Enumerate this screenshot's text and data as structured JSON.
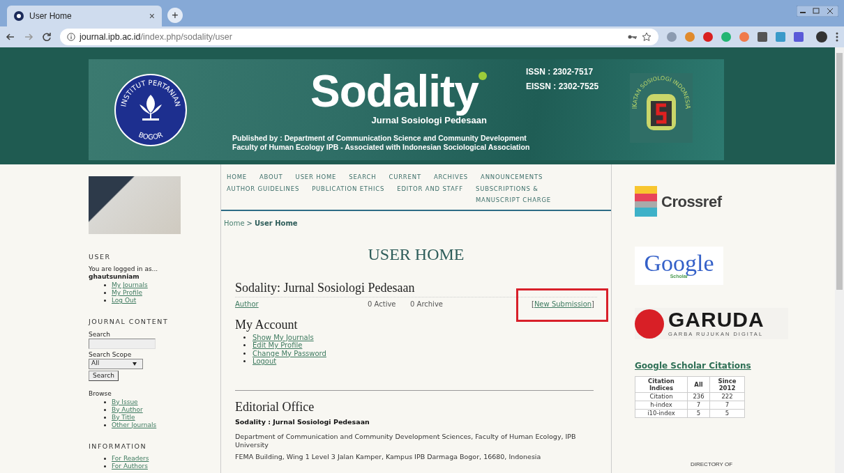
{
  "browser": {
    "tab": {
      "title": "User Home",
      "close": "×"
    },
    "new_tab": "+",
    "url": {
      "host": "journal.ipb.ac.id",
      "path": "/index.php/sodality/user"
    }
  },
  "banner": {
    "seal_text_top": "INSTITUT PERTANIAN",
    "seal_text_bottom": "BOGOR",
    "title": "Sodality",
    "subtitle": "Jurnal Sosiologi Pedesaan",
    "issn": "ISSN : 2302-7517",
    "eissn": "EISSN : 2302-7525",
    "published_lines": [
      "Published by : Department of Communication Science and Community Development",
      "Faculty of Human Ecology IPB - Associated with Indonesian Sociological Association"
    ],
    "association_text": "IKATAN SOSIOLOGI INDONESIA"
  },
  "sidebar": {
    "user": {
      "heading": "USER",
      "logged_in": "You are logged in as...",
      "username": "ghautsunniam",
      "links": [
        "My Journals",
        "My Profile",
        "Log Out"
      ]
    },
    "journal_content": {
      "heading": "JOURNAL CONTENT",
      "search_label": "Search",
      "scope_label": "Search Scope",
      "scope_value": "All",
      "search_button": "Search",
      "browse_label": "Browse",
      "browse_links": [
        "By Issue",
        "By Author",
        "By Title",
        "Other Journals"
      ]
    },
    "information": {
      "heading": "INFORMATION",
      "links": [
        "For Readers",
        "For Authors"
      ]
    }
  },
  "nav": [
    "HOME",
    "ABOUT",
    "USER HOME",
    "SEARCH",
    "CURRENT",
    "ARCHIVES",
    "ANNOUNCEMENTS",
    "AUTHOR GUIDELINES",
    "PUBLICATION ETHICS",
    "EDITOR AND STAFF",
    "SUBSCRIPTIONS & MANUSCRIPT CHARGE"
  ],
  "breadcrumb": {
    "home": "Home",
    "separator": ">",
    "current": "User Home"
  },
  "main": {
    "title": "USER HOME",
    "journal": {
      "name": "Sodality: Jurnal Sosiologi Pedesaan",
      "role": "Author",
      "active": "0 Active",
      "archive": "0 Archive",
      "new_submission": {
        "prefix": "[",
        "label": "New Submission",
        "suffix": "]",
        "highlighted": true
      }
    },
    "account": {
      "heading": "My Account",
      "links": [
        "Show My Journals",
        "Edit My Profile",
        "Change My Password",
        "Logout"
      ]
    },
    "editorial": {
      "heading": "Editorial Office",
      "name": "Sodality : Jurnal Sosiologi Pedesaan",
      "department": "Department of Communication and Community Development Sciences, Faculty of Human Ecology, IPB University",
      "address": "FEMA Building, Wing 1 Level 3 Jalan Kamper, Kampus IPB Darmaga Bogor, 16680, Indonesia"
    }
  },
  "right": {
    "crossref": "Crossref",
    "scholar": {
      "word": "Google",
      "sub": "Scholar"
    },
    "garuda": {
      "word": "GARUDA",
      "sub": "GARBA RUJUKAN DIGITAL"
    },
    "citations": {
      "heading": "Google Scholar Citations",
      "columns": [
        "Citation Indices",
        "All",
        "Since 2012"
      ],
      "rows": [
        [
          "Citation",
          "236",
          "222"
        ],
        [
          "h-index",
          "7",
          "7"
        ],
        [
          "i10-index",
          "5",
          "5"
        ]
      ]
    },
    "doaj": "DIRECTORY OF"
  }
}
